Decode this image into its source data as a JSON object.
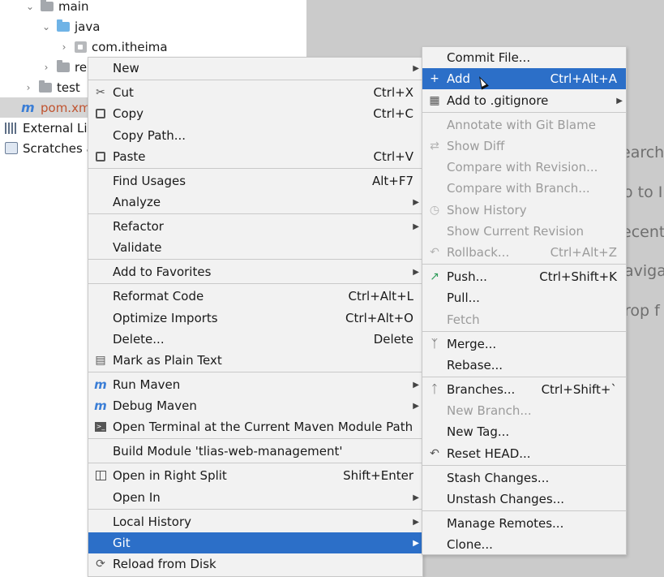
{
  "tree": {
    "items": [
      {
        "label": "main",
        "chevron": "⌄",
        "icon": "folder-gray-icon"
      },
      {
        "label": "java",
        "chevron": "⌄",
        "icon": "folder-blue-icon"
      },
      {
        "label": "com.itheima",
        "chevron": "›",
        "icon": "package-icon"
      },
      {
        "label": "re",
        "chevron": "›",
        "icon": "resources-folder-icon"
      },
      {
        "label": "test",
        "chevron": "›",
        "icon": "folder-gray-icon"
      },
      {
        "label": "pom.xm",
        "icon": "maven-file-icon",
        "selected": true
      },
      {
        "label": "External Lib",
        "icon": "library-icon"
      },
      {
        "label": "Scratches a",
        "icon": "scratches-icon"
      }
    ]
  },
  "editor": {
    "hints": [
      "earch",
      "o to I",
      "ecent",
      "aviga",
      "rop f"
    ]
  },
  "context_menu": {
    "items": [
      {
        "label": "New",
        "submenu": true
      },
      {
        "label": "Cut",
        "shortcut": "Ctrl+X",
        "icon": "scissors-icon"
      },
      {
        "label": "Copy",
        "shortcut": "Ctrl+C",
        "icon": "copy-icon"
      },
      {
        "label": "Copy Path..."
      },
      {
        "label": "Paste",
        "shortcut": "Ctrl+V",
        "icon": "paste-icon"
      },
      {
        "label": "Find Usages",
        "shortcut": "Alt+F7"
      },
      {
        "label": "Analyze",
        "submenu": true
      },
      {
        "label": "Refactor",
        "submenu": true
      },
      {
        "label": "Validate"
      },
      {
        "label": "Add to Favorites",
        "submenu": true
      },
      {
        "label": "Reformat Code",
        "shortcut": "Ctrl+Alt+L"
      },
      {
        "label": "Optimize Imports",
        "shortcut": "Ctrl+Alt+O"
      },
      {
        "label": "Delete...",
        "shortcut": "Delete"
      },
      {
        "label": "Mark as Plain Text",
        "icon": "plain-text-icon"
      },
      {
        "label": "Run Maven",
        "submenu": true,
        "icon": "run-maven-icon"
      },
      {
        "label": "Debug Maven",
        "submenu": true,
        "icon": "debug-maven-icon"
      },
      {
        "label": "Open Terminal at the Current Maven Module Path",
        "icon": "terminal-icon"
      },
      {
        "label": "Build Module 'tlias-web-management'"
      },
      {
        "label": "Open in Right Split",
        "shortcut": "Shift+Enter",
        "icon": "split-icon"
      },
      {
        "label": "Open In",
        "submenu": true
      },
      {
        "label": "Local History",
        "submenu": true
      },
      {
        "label": "Git",
        "submenu": true,
        "highlighted": true
      },
      {
        "label": "Reload from Disk",
        "icon": "reload-icon"
      }
    ]
  },
  "git_menu": {
    "items": [
      {
        "label": "Commit File..."
      },
      {
        "label": "Add",
        "shortcut": "Ctrl+Alt+A",
        "icon": "plus-icon",
        "highlighted": true
      },
      {
        "label": "Add to .gitignore",
        "submenu": true,
        "icon": "gitignore-icon"
      },
      {
        "label": "Annotate with Git Blame",
        "disabled": true
      },
      {
        "label": "Show Diff",
        "disabled": true,
        "icon": "diff-icon"
      },
      {
        "label": "Compare with Revision...",
        "disabled": true
      },
      {
        "label": "Compare with Branch...",
        "disabled": true
      },
      {
        "label": "Show History",
        "disabled": true,
        "icon": "history-icon"
      },
      {
        "label": "Show Current Revision",
        "disabled": true
      },
      {
        "label": "Rollback...",
        "shortcut": "Ctrl+Alt+Z",
        "disabled": true,
        "icon": "rollback-icon"
      },
      {
        "label": "Push...",
        "shortcut": "Ctrl+Shift+K",
        "icon": "push-icon"
      },
      {
        "label": "Pull..."
      },
      {
        "label": "Fetch",
        "disabled": true
      },
      {
        "label": "Merge...",
        "icon": "merge-icon"
      },
      {
        "label": "Rebase..."
      },
      {
        "label": "Branches...",
        "shortcut": "Ctrl+Shift+`",
        "icon": "branch-icon"
      },
      {
        "label": "New Branch...",
        "disabled": true
      },
      {
        "label": "New Tag..."
      },
      {
        "label": "Reset HEAD...",
        "icon": "reset-icon"
      },
      {
        "label": "Stash Changes..."
      },
      {
        "label": "Unstash Changes..."
      },
      {
        "label": "Manage Remotes..."
      },
      {
        "label": "Clone..."
      }
    ]
  },
  "colors": {
    "highlight": "#2c6fc8",
    "menu_bg": "#f2f2f2",
    "editor_bg": "#cbcbcb"
  }
}
